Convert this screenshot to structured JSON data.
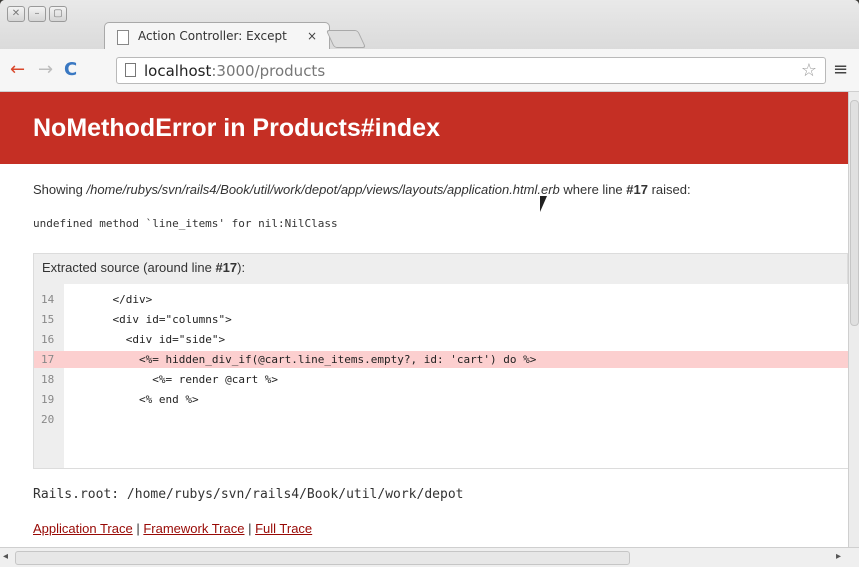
{
  "window": {
    "buttons": [
      "✕",
      "–",
      "▢"
    ]
  },
  "tab": {
    "title": "Action Controller: Except",
    "close": "×"
  },
  "address_bar": {
    "url_host": "localhost",
    "url_rest": ":3000/products"
  },
  "page": {
    "error_title": "NoMethodError in Products#index",
    "showing_prefix": "Showing ",
    "showing_path": "/home/rubys/svn/rails4/Book/util/work/depot/app/views/layouts/application.html.erb",
    "showing_mid": " where line ",
    "showing_line": "#17",
    "showing_suffix": " raised:",
    "message": "undefined method `line_items' for nil:NilClass",
    "source_head_prefix": "Extracted source (around line ",
    "source_head_line": "#17",
    "source_head_suffix": "):",
    "code_lines": [
      {
        "num": "14",
        "code": "    </div>",
        "highlight": false
      },
      {
        "num": "15",
        "code": "    <div id=\"columns\">",
        "highlight": false
      },
      {
        "num": "16",
        "code": "      <div id=\"side\">",
        "highlight": false
      },
      {
        "num": "17",
        "code": "        <%= hidden_div_if(@cart.line_items.empty?, id: 'cart') do %>",
        "highlight": true
      },
      {
        "num": "18",
        "code": "          <%= render @cart %>",
        "highlight": false
      },
      {
        "num": "19",
        "code": "        <% end %>",
        "highlight": false
      },
      {
        "num": "20",
        "code": "",
        "highlight": false
      }
    ],
    "rails_root": "Rails.root: /home/rubys/svn/rails4/Book/util/work/depot",
    "trace_links": [
      "Application Trace",
      "Framework Trace",
      "Full Trace"
    ],
    "trace_sep": " | "
  },
  "icons": {
    "back": "←",
    "forward": "→",
    "reload": "C",
    "star": "☆",
    "menu": "≡",
    "scroll_left": "◂",
    "scroll_right": "▸"
  }
}
